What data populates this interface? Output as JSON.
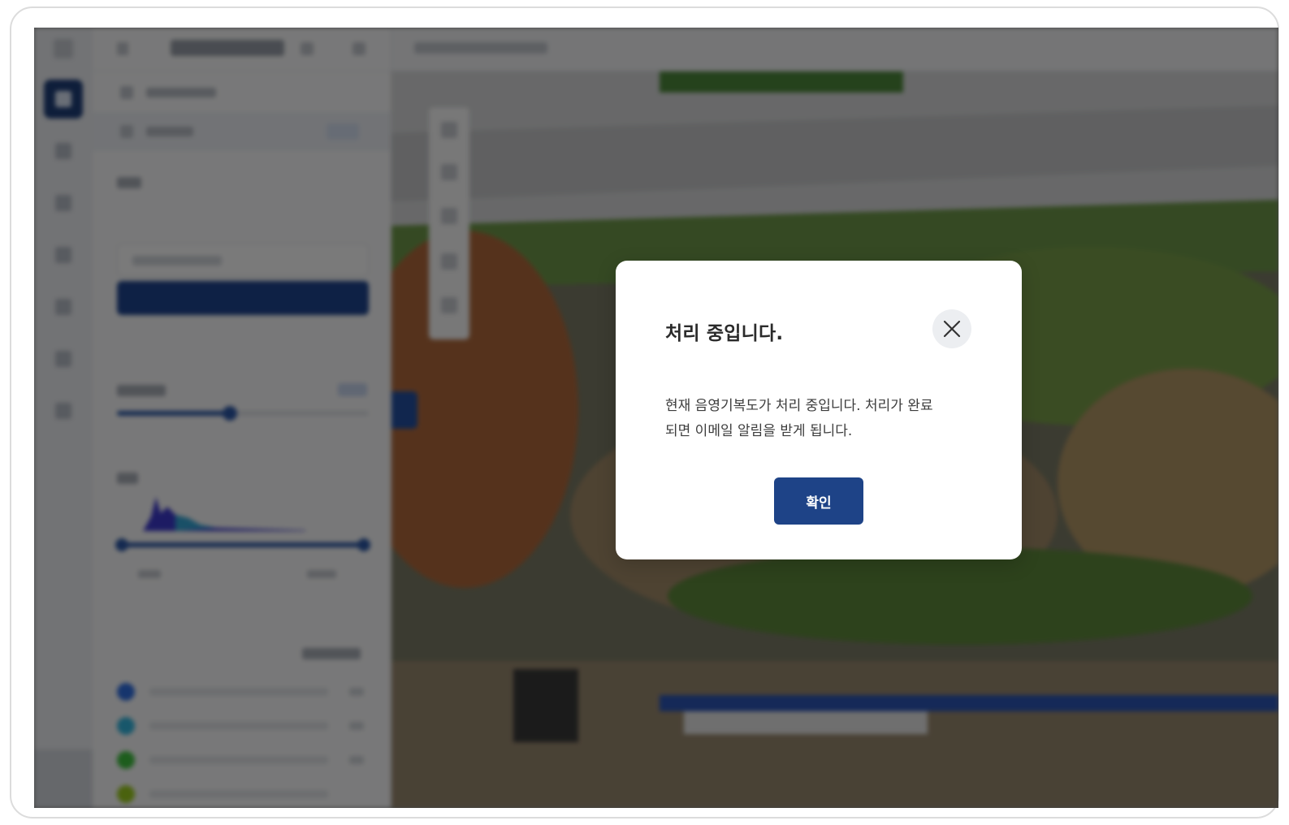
{
  "dialog": {
    "title": "처리 중입니다.",
    "message_line1": "현재 음영기복도가 처리 중입니다. 처리가 완료",
    "message_line2": "되면 이메일 알림을 받게 됩니다.",
    "confirm_label": "확인",
    "close_icon": "close-icon"
  },
  "background": {
    "state": "blurred-dimmed",
    "sidebar_icons": [
      "logo-icon",
      "map-layer-icon",
      "grid-icon",
      "measure-icon",
      "document-icon",
      "image-icon",
      "settings-icon",
      "share-icon",
      "expand-icon"
    ],
    "legend_colors": [
      "#2f6fe4",
      "#33b7e0",
      "#3ec23e",
      "#9ccd1f"
    ]
  },
  "colors": {
    "accent": "#1e4387",
    "overlay": "rgba(0,0,0,0.52)",
    "rail_active": "#1f3f7a"
  }
}
